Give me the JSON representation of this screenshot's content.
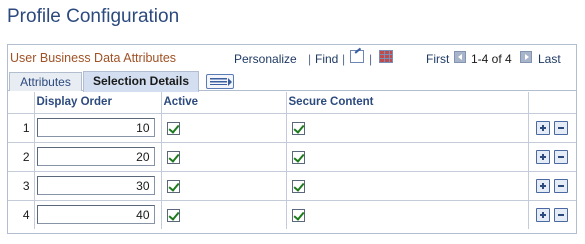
{
  "page": {
    "title": "Profile Configuration"
  },
  "grid": {
    "title": "User Business Data Attributes",
    "nav": {
      "personalize": "Personalize",
      "separator": "|",
      "find": "Find",
      "separator2": "|",
      "first": "First",
      "range": "1-4 of 4",
      "last": "Last",
      "icons": [
        "view-all-icon",
        "download-grid-icon",
        "previous-arrow-icon",
        "next-arrow-icon"
      ]
    },
    "tabs": [
      {
        "label": "Attributes",
        "active": false
      },
      {
        "label": "Selection Details",
        "active": true
      }
    ],
    "columns": [
      "Display Order",
      "Active",
      "Secure Content"
    ],
    "rows": [
      {
        "num": "1",
        "display_order": "10",
        "active": true,
        "secure": true
      },
      {
        "num": "2",
        "display_order": "20",
        "active": true,
        "secure": true
      },
      {
        "num": "3",
        "display_order": "30",
        "active": true,
        "secure": true
      },
      {
        "num": "4",
        "display_order": "40",
        "active": true,
        "secure": true
      }
    ]
  },
  "colors": {
    "title": "#2c4a7e",
    "grid_title": "#a05226",
    "checkmark": "#1d7a1d"
  }
}
